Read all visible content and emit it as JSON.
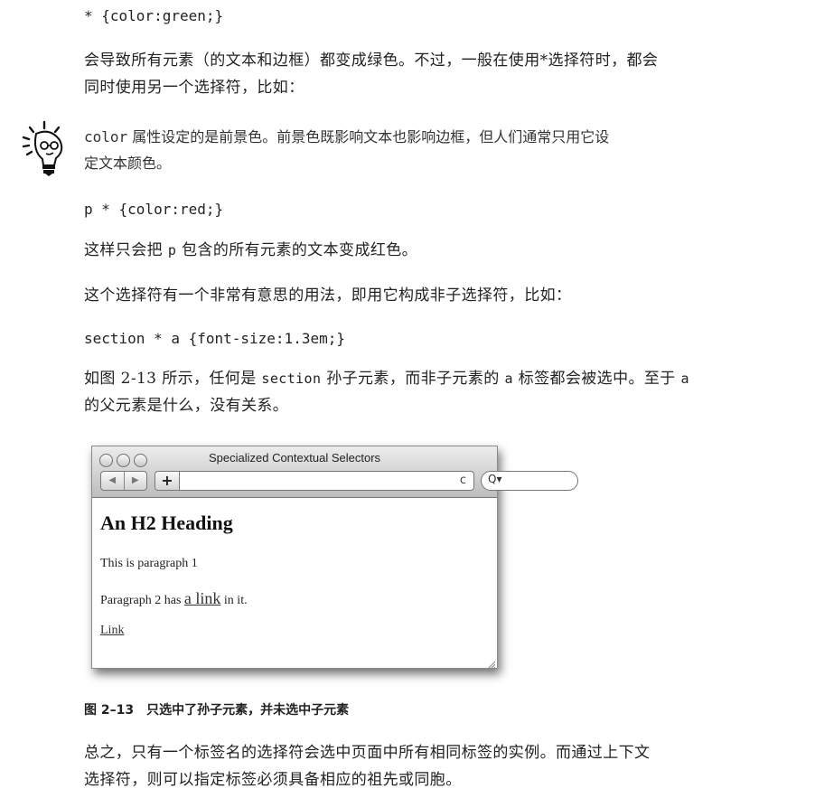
{
  "code1": "* {color:green;}",
  "para1_line1": "会导致所有元素（的文本和边框）都变成绿色。不过，一般在使用*选择符时，都会",
  "para1_line2": "同时使用另一个选择符，比如：",
  "tip": {
    "icon": "lightbulb-tip-icon",
    "mono": "color",
    "line1_rest": " 属性设定的是前景色。前景色既影响文本也影响边框，但人们通常只用它设",
    "line2": "定文本颜色。"
  },
  "code2": "p * {color:red;}",
  "para2_a": "这样只会把 ",
  "para2_mono": "p",
  "para2_b": " 包含的所有元素的文本变成红色。",
  "para3": "这个选择符有一个非常有意思的用法，即用它构成非子选择符，比如：",
  "code3": "section * a {font-size:1.3em;}",
  "para4_line1_a": "如图 2-13 所示，任何是 ",
  "para4_line1_mono": "section",
  "para4_line1_b": " 孙子元素，而非子元素的 ",
  "para4_line1_mono2": "a",
  "para4_line1_c": " 标签都会被选中。至于 ",
  "para4_line1_mono3": "a",
  "para4_line2": "的父元素是什么，没有关系。",
  "figure": {
    "window_title": "Specialized Contextual Selectors",
    "back": "◀",
    "forward": "▶",
    "add": "+",
    "reload": "c",
    "search_glyph": "Q▾",
    "heading": "An H2 Heading",
    "p1": "This is paragraph 1",
    "p2_a": "Paragraph 2 has ",
    "p2_link": "a link",
    "p2_b": " in it.",
    "link": "Link"
  },
  "caption": "图 2–13　只选中了孙子元素，并未选中子元素",
  "para5_line1": "总之，只有一个标签名的选择符会选中页面中所有相同标签的实例。而通过上下文",
  "para5_line2": "选择符，则可以指定标签必须具备相应的祖先或同胞。"
}
